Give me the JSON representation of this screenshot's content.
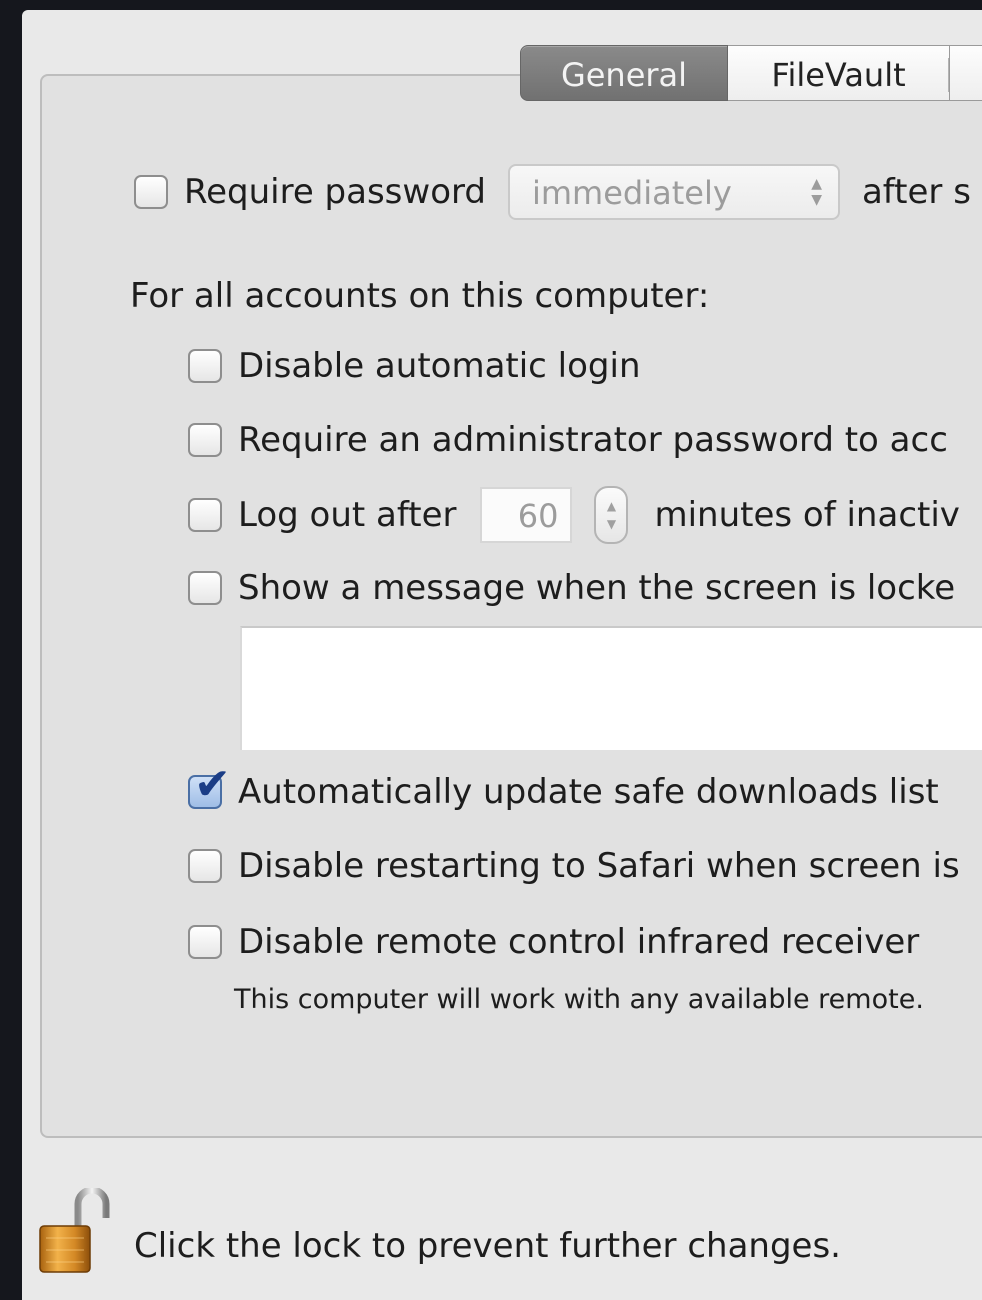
{
  "tabs": [
    {
      "label": "General",
      "active": true
    },
    {
      "label": "FileVault",
      "active": false
    }
  ],
  "require_password": {
    "label": "Require password",
    "checked": false,
    "popup_value": "immediately",
    "after_label": "after s"
  },
  "all_accounts_heading": "For all accounts on this computer:",
  "options": {
    "disable_auto_login": {
      "label": "Disable automatic login",
      "checked": false
    },
    "require_admin": {
      "label": "Require an administrator password to acc",
      "checked": false
    },
    "log_out": {
      "label": "Log out after",
      "checked": false,
      "minutes_value": "60",
      "suffix": "minutes of inactiv"
    },
    "show_message": {
      "label": "Show a message when the screen is locke",
      "checked": false,
      "message_value": ""
    },
    "auto_update": {
      "label": "Automatically update safe downloads list",
      "checked": true
    },
    "disable_restart_safari": {
      "label": "Disable restarting to Safari when screen is",
      "checked": false
    },
    "disable_remote": {
      "label": "Disable remote control infrared receiver",
      "checked": false
    }
  },
  "remote_note": "This computer will work with any available remote.",
  "lock": {
    "text": "Click the lock to prevent further changes.",
    "icon": "unlocked-padlock-icon"
  },
  "colors": {
    "panel_bg": "#e1e1e1",
    "active_tab": "#7d7d7d",
    "check_blue": "#1b3d86",
    "desktop": "#15171d"
  }
}
